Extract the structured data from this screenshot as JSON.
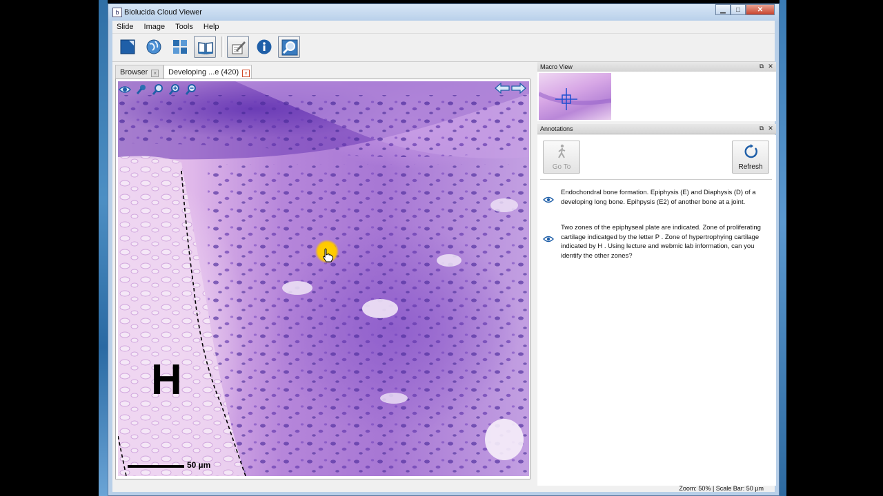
{
  "window": {
    "title": "Biolucida Cloud Viewer",
    "controls": {
      "minimize": "▁",
      "maximize": "□",
      "close": "✕"
    }
  },
  "menu": [
    "Slide",
    "Image",
    "Tools",
    "Help"
  ],
  "toolbar": {
    "buttons": [
      "close-slide-icon",
      "globe-icon",
      "tiles-icon",
      "book-icon",
      "annotate-icon",
      "info-icon",
      "zoom-search-icon"
    ]
  },
  "tabs": [
    {
      "label": "Browser",
      "close": "×"
    },
    {
      "label": "Developing ...e (420)",
      "close": "×"
    }
  ],
  "viewer": {
    "overlay_letter": "H",
    "scale_label": "50 µm",
    "tools": [
      "eye-icon",
      "wrench-icon",
      "magnifier-icon",
      "zoom-in-icon",
      "zoom-out-icon"
    ],
    "nav": [
      "arrow-left-icon",
      "arrow-right-icon"
    ]
  },
  "macro_panel": {
    "title": "Macro View",
    "float": "⧉",
    "close": "✕"
  },
  "annotations_panel": {
    "title": "Annotations",
    "float": "⧉",
    "close": "✕",
    "goto_label": "Go To",
    "refresh_label": "Refresh",
    "items": [
      {
        "text": "Endochondral bone formation.  Epiphysis (E) and Diaphysis (D) of a developing long bone.  Epihpysis (E2) of another bone at a joint."
      },
      {
        "text": "Two zones of the epiphyseal plate are indicated.  Zone of proliferating cartilage indicatged by the letter P .  Zone of hypertrophying cartilage indicated by H .  Using lecture and webmic lab information, can you identify the other zones?"
      }
    ]
  },
  "status": {
    "text": "Zoom: 50% | Scale Bar: 50 µm"
  },
  "colors": {
    "accent": "#2c6fb0",
    "cursor_highlight": "#ffc800",
    "stain": "#a777d4"
  }
}
